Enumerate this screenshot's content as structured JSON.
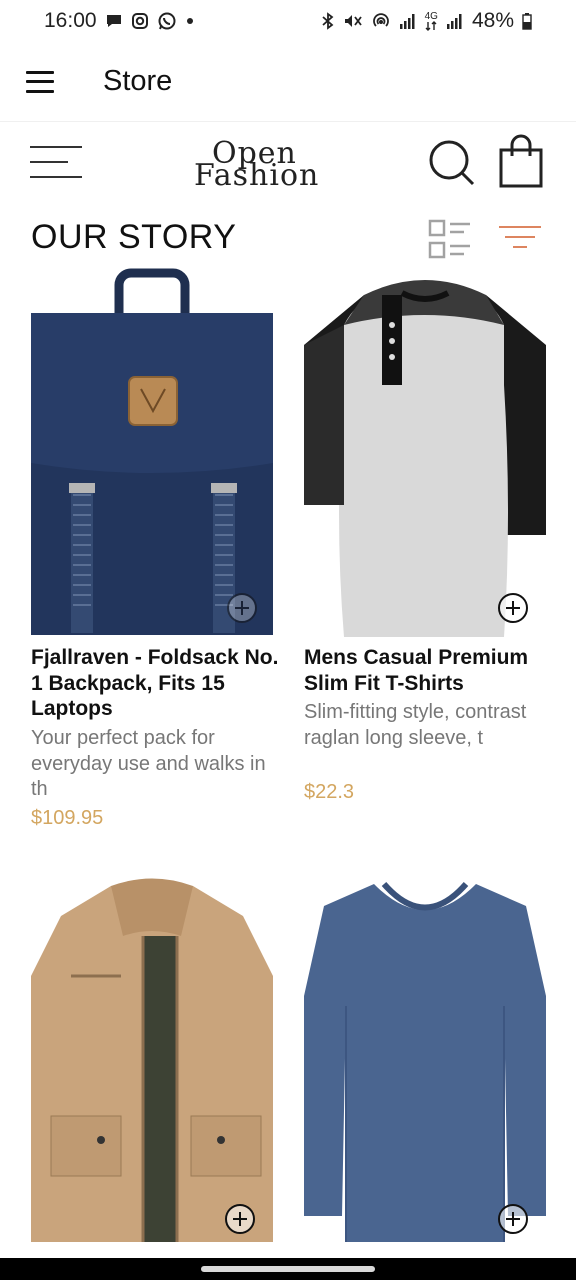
{
  "status_bar": {
    "time": "16:00",
    "battery": "48%",
    "network": "4G",
    "left_icons": [
      "message-icon",
      "instagram-icon",
      "whatsapp-icon",
      "dot-icon"
    ],
    "right_icons": [
      "bluetooth-icon",
      "mute-icon",
      "hotspot-icon",
      "signal-icon",
      "signal-4g-icon",
      "battery-icon"
    ]
  },
  "app_bar": {
    "title": "Store"
  },
  "brand": {
    "logo_line1": "Open",
    "logo_line2": "Fashion"
  },
  "section": {
    "title": "OUR STORY"
  },
  "colors": {
    "accent": "#dd8560",
    "price": "#d3a660",
    "description": "#777777"
  },
  "products": [
    {
      "name": "Fjallraven - Foldsack No. 1 Backpack, Fits 15 Laptops",
      "description": "Your perfect pack for everyday use and walks in th",
      "price": "$109.95",
      "image": "navy-backpack"
    },
    {
      "name": "Mens Casual Premium Slim Fit T-Shirts",
      "description": "Slim-fitting style, contrast raglan long sleeve, t",
      "price": "$22.3",
      "image": "grey-black-raglan-tshirt"
    },
    {
      "name": "",
      "description": "",
      "price": "",
      "image": "khaki-jacket"
    },
    {
      "name": "",
      "description": "",
      "price": "",
      "image": "blue-long-sleeve-tee"
    }
  ]
}
